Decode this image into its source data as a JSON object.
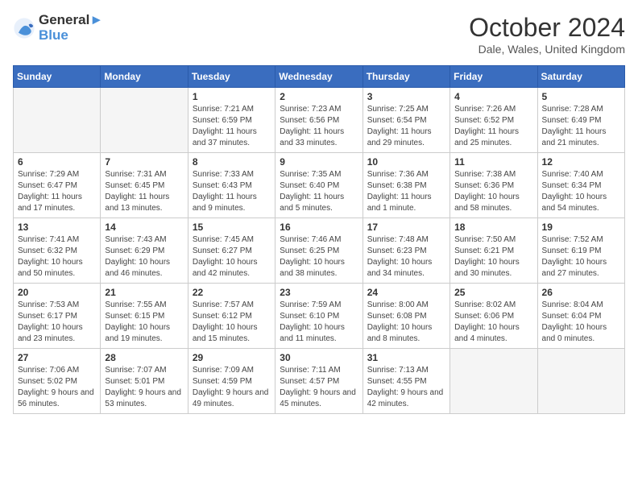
{
  "logo": {
    "line1": "General",
    "line2": "Blue"
  },
  "title": "October 2024",
  "subtitle": "Dale, Wales, United Kingdom",
  "headers": [
    "Sunday",
    "Monday",
    "Tuesday",
    "Wednesday",
    "Thursday",
    "Friday",
    "Saturday"
  ],
  "weeks": [
    [
      {
        "day": "",
        "empty": true
      },
      {
        "day": "",
        "empty": true
      },
      {
        "day": "1",
        "sunrise": "7:21 AM",
        "sunset": "6:59 PM",
        "daylight": "11 hours and 37 minutes."
      },
      {
        "day": "2",
        "sunrise": "7:23 AM",
        "sunset": "6:56 PM",
        "daylight": "11 hours and 33 minutes."
      },
      {
        "day": "3",
        "sunrise": "7:25 AM",
        "sunset": "6:54 PM",
        "daylight": "11 hours and 29 minutes."
      },
      {
        "day": "4",
        "sunrise": "7:26 AM",
        "sunset": "6:52 PM",
        "daylight": "11 hours and 25 minutes."
      },
      {
        "day": "5",
        "sunrise": "7:28 AM",
        "sunset": "6:49 PM",
        "daylight": "11 hours and 21 minutes."
      }
    ],
    [
      {
        "day": "6",
        "sunrise": "7:29 AM",
        "sunset": "6:47 PM",
        "daylight": "11 hours and 17 minutes."
      },
      {
        "day": "7",
        "sunrise": "7:31 AM",
        "sunset": "6:45 PM",
        "daylight": "11 hours and 13 minutes."
      },
      {
        "day": "8",
        "sunrise": "7:33 AM",
        "sunset": "6:43 PM",
        "daylight": "11 hours and 9 minutes."
      },
      {
        "day": "9",
        "sunrise": "7:35 AM",
        "sunset": "6:40 PM",
        "daylight": "11 hours and 5 minutes."
      },
      {
        "day": "10",
        "sunrise": "7:36 AM",
        "sunset": "6:38 PM",
        "daylight": "11 hours and 1 minute."
      },
      {
        "day": "11",
        "sunrise": "7:38 AM",
        "sunset": "6:36 PM",
        "daylight": "10 hours and 58 minutes."
      },
      {
        "day": "12",
        "sunrise": "7:40 AM",
        "sunset": "6:34 PM",
        "daylight": "10 hours and 54 minutes."
      }
    ],
    [
      {
        "day": "13",
        "sunrise": "7:41 AM",
        "sunset": "6:32 PM",
        "daylight": "10 hours and 50 minutes."
      },
      {
        "day": "14",
        "sunrise": "7:43 AM",
        "sunset": "6:29 PM",
        "daylight": "10 hours and 46 minutes."
      },
      {
        "day": "15",
        "sunrise": "7:45 AM",
        "sunset": "6:27 PM",
        "daylight": "10 hours and 42 minutes."
      },
      {
        "day": "16",
        "sunrise": "7:46 AM",
        "sunset": "6:25 PM",
        "daylight": "10 hours and 38 minutes."
      },
      {
        "day": "17",
        "sunrise": "7:48 AM",
        "sunset": "6:23 PM",
        "daylight": "10 hours and 34 minutes."
      },
      {
        "day": "18",
        "sunrise": "7:50 AM",
        "sunset": "6:21 PM",
        "daylight": "10 hours and 30 minutes."
      },
      {
        "day": "19",
        "sunrise": "7:52 AM",
        "sunset": "6:19 PM",
        "daylight": "10 hours and 27 minutes."
      }
    ],
    [
      {
        "day": "20",
        "sunrise": "7:53 AM",
        "sunset": "6:17 PM",
        "daylight": "10 hours and 23 minutes."
      },
      {
        "day": "21",
        "sunrise": "7:55 AM",
        "sunset": "6:15 PM",
        "daylight": "10 hours and 19 minutes."
      },
      {
        "day": "22",
        "sunrise": "7:57 AM",
        "sunset": "6:12 PM",
        "daylight": "10 hours and 15 minutes."
      },
      {
        "day": "23",
        "sunrise": "7:59 AM",
        "sunset": "6:10 PM",
        "daylight": "10 hours and 11 minutes."
      },
      {
        "day": "24",
        "sunrise": "8:00 AM",
        "sunset": "6:08 PM",
        "daylight": "10 hours and 8 minutes."
      },
      {
        "day": "25",
        "sunrise": "8:02 AM",
        "sunset": "6:06 PM",
        "daylight": "10 hours and 4 minutes."
      },
      {
        "day": "26",
        "sunrise": "8:04 AM",
        "sunset": "6:04 PM",
        "daylight": "10 hours and 0 minutes."
      }
    ],
    [
      {
        "day": "27",
        "sunrise": "7:06 AM",
        "sunset": "5:02 PM",
        "daylight": "9 hours and 56 minutes."
      },
      {
        "day": "28",
        "sunrise": "7:07 AM",
        "sunset": "5:01 PM",
        "daylight": "9 hours and 53 minutes."
      },
      {
        "day": "29",
        "sunrise": "7:09 AM",
        "sunset": "4:59 PM",
        "daylight": "9 hours and 49 minutes."
      },
      {
        "day": "30",
        "sunrise": "7:11 AM",
        "sunset": "4:57 PM",
        "daylight": "9 hours and 45 minutes."
      },
      {
        "day": "31",
        "sunrise": "7:13 AM",
        "sunset": "4:55 PM",
        "daylight": "9 hours and 42 minutes."
      },
      {
        "day": "",
        "empty": true
      },
      {
        "day": "",
        "empty": true
      }
    ]
  ]
}
